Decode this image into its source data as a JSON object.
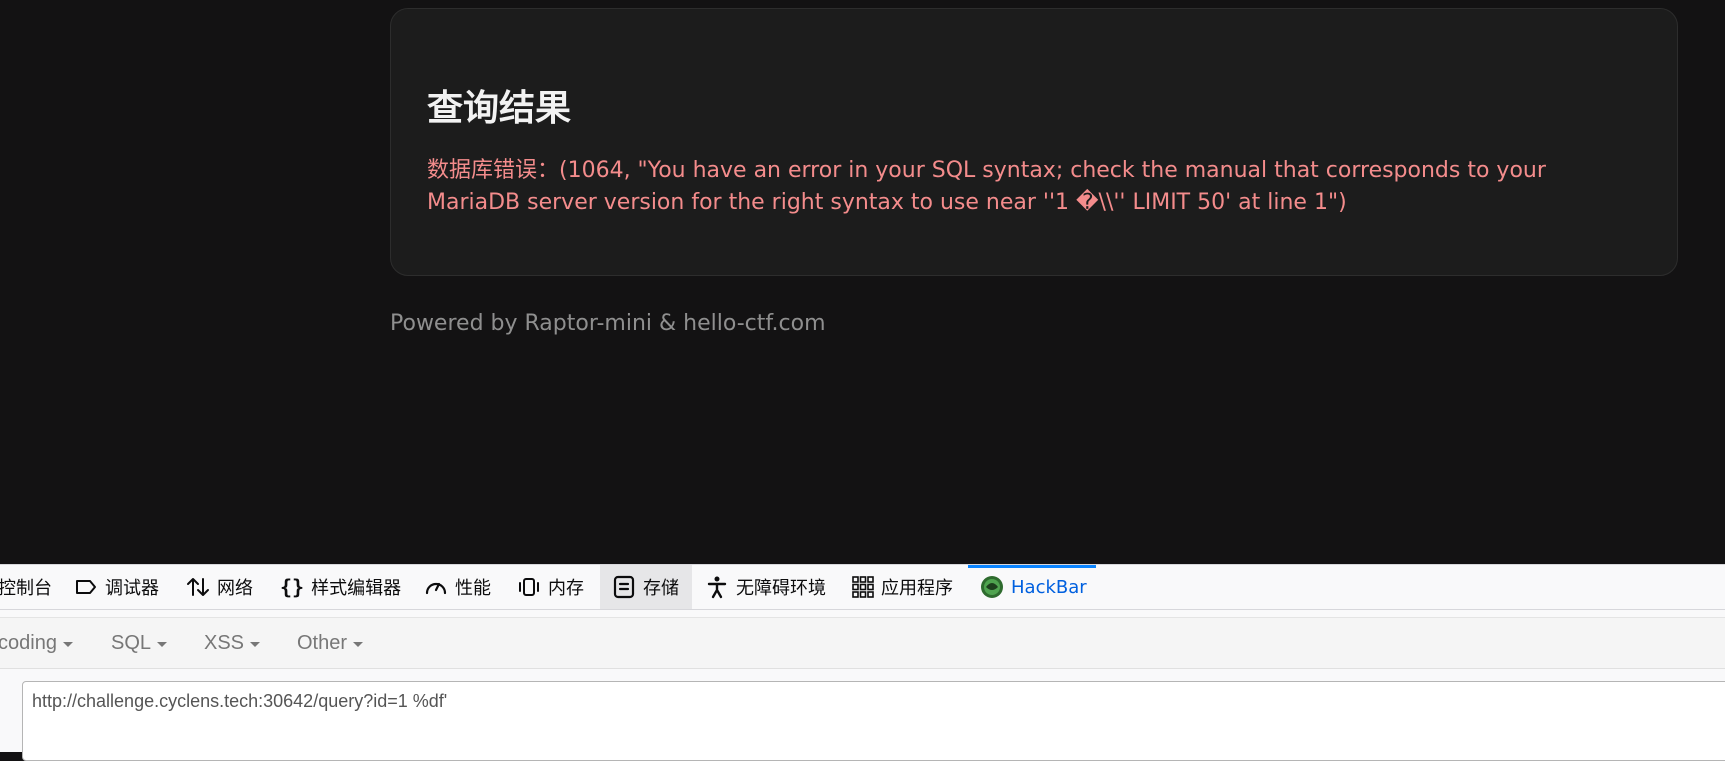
{
  "page": {
    "result_title": "查询结果",
    "error_message": "数据库错误：(1064, \"You have an error in your SQL syntax; check the manual that corresponds to your MariaDB server version for the right syntax to use near ''1 �\\\\'' LIMIT 50' at line 1\")",
    "footer": "Powered by Raptor-mini & hello-ctf.com"
  },
  "devtools": {
    "tabs": [
      {
        "label": "控制台",
        "icon": "console-icon"
      },
      {
        "label": "调试器",
        "icon": "debugger-icon"
      },
      {
        "label": "网络",
        "icon": "network-icon"
      },
      {
        "label": "样式编辑器",
        "icon": "style-editor-icon"
      },
      {
        "label": "性能",
        "icon": "performance-icon"
      },
      {
        "label": "内存",
        "icon": "memory-icon"
      },
      {
        "label": "存储",
        "icon": "storage-icon"
      },
      {
        "label": "无障碍环境",
        "icon": "accessibility-icon"
      },
      {
        "label": "应用程序",
        "icon": "application-icon"
      },
      {
        "label": "HackBar",
        "icon": "hackbar-icon"
      }
    ],
    "selected_tab": "存储",
    "active_tab": "HackBar"
  },
  "hackbar": {
    "menus": [
      "coding",
      "SQL",
      "XSS",
      "Other"
    ],
    "url": "http://challenge.cyclens.tech:30642/query?id=1 %df'"
  },
  "colors": {
    "page_background": "#131213",
    "card_background": "#1c1c1c",
    "error_text": "#f48c8c",
    "active_tab": "#0060df"
  }
}
